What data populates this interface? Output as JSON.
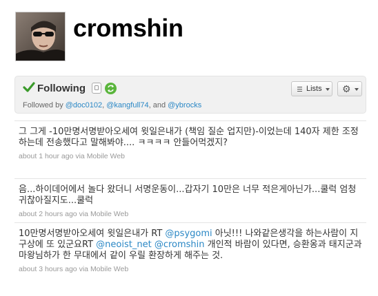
{
  "profile": {
    "username": "cromshin",
    "avatar_alt": "profile-photo"
  },
  "follow": {
    "status_label": "Following",
    "lists_label": "Lists",
    "followed_by_prefix": "Followed by",
    "followers": [
      "@doc0102",
      "@kangfull74",
      "@ybrocks"
    ],
    "and_text": "and"
  },
  "tweets": [
    {
      "text": "그 그게 -10만명서명받아오세여 윗일은내가 (책임 질순 업지만)-이었는데 140자 제한 조정하는데 전송했다고 말해봐야.... ㅋㅋㅋㅋ 안들어먹겠지?",
      "time": "about 1 hour ago",
      "via": "via",
      "source": "Mobile Web"
    },
    {
      "text": "음...하이데어에서 놀다 왔더니 서명운동이...갑자기 10만은 너무 적은게아닌가...쿨럭 엄청 귀찮아질지도...쿨럭",
      "time": "about 2 hours ago",
      "via": "via",
      "source": "Mobile Web"
    },
    {
      "parts": [
        "10만명서명받아오세여 윗일은내가 RT ",
        "@psygomi",
        " 아닛!!! 나와같은생각을 하는사람이 지구상에 또 있군요RT ",
        "@neoist_net",
        " ",
        "@cromshin",
        " 개인적 바람이 있다면, 승환옹과 태지군과 마왕님하가 한 무대에서 같이 우릴 환장하게 해주는 것."
      ],
      "time": "about 3 hours ago",
      "via": "via",
      "source": "Mobile Web"
    }
  ],
  "colors": {
    "link": "#2a87c5",
    "check": "#3a9a2a",
    "retweet": "#5ab53c"
  },
  "icons": [
    "check-icon",
    "sms-icon",
    "retweet-icon",
    "list-icon",
    "gear-icon"
  ]
}
